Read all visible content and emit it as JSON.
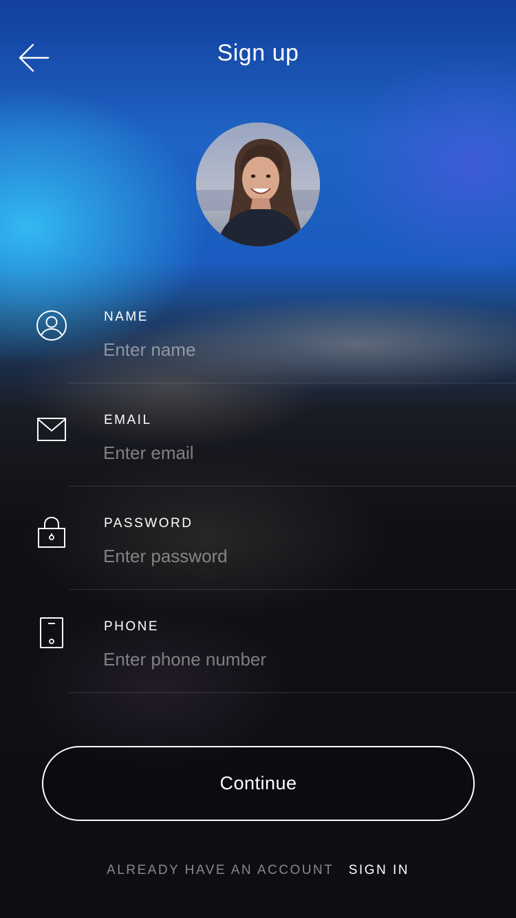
{
  "header": {
    "title": "Sign up"
  },
  "icons": {
    "back": "arrow-left-icon",
    "name": "user-icon",
    "email": "envelope-icon",
    "password": "lock-icon",
    "phone": "phone-icon"
  },
  "form": {
    "name": {
      "label": "NAME",
      "placeholder": "Enter name",
      "value": ""
    },
    "email": {
      "label": "EMAIL",
      "placeholder": "Enter email",
      "value": ""
    },
    "password": {
      "label": "PASSWORD",
      "placeholder": "Enter password",
      "value": ""
    },
    "phone": {
      "label": "PHONE",
      "placeholder": "Enter phone number",
      "value": ""
    }
  },
  "actions": {
    "continue_label": "Continue"
  },
  "footer": {
    "question": "ALREADY HAVE AN ACCOUNT",
    "sign_in_label": "SIGN IN"
  },
  "colors": {
    "top_blue": "#1e64c4",
    "accent_cyan": "#34bef5",
    "background_dark": "#0d0e12",
    "text": "#ffffff"
  }
}
